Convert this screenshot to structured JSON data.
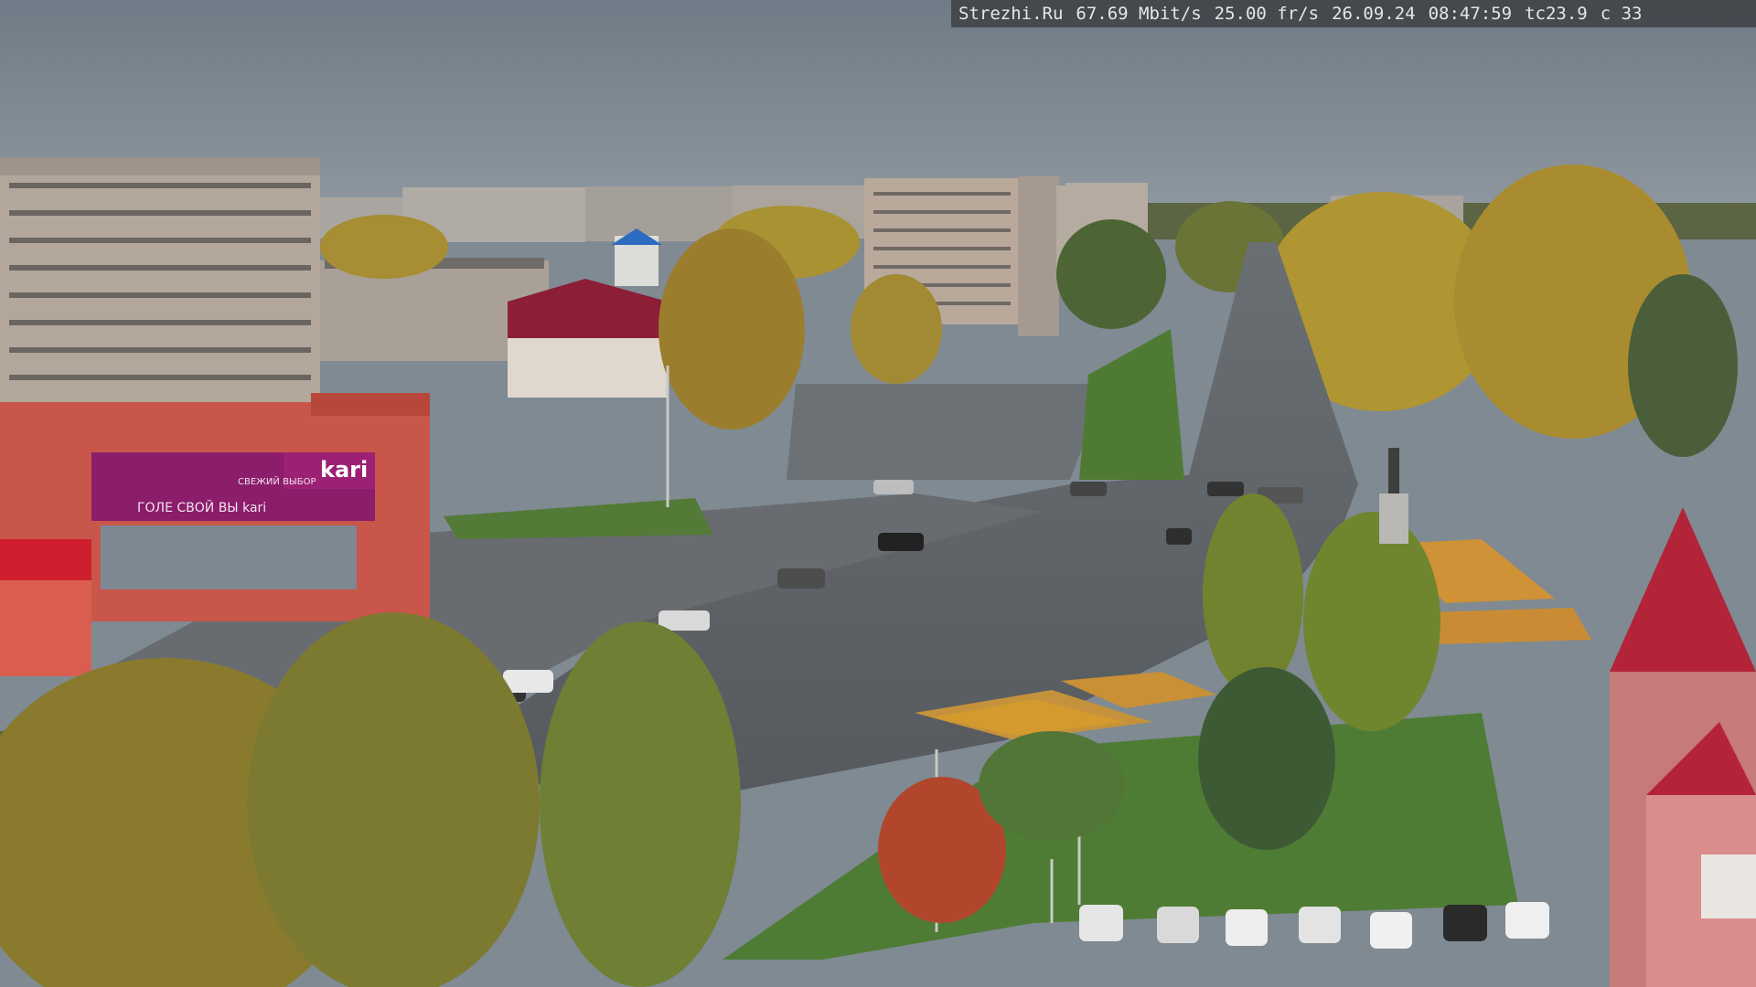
{
  "overlay": {
    "site": "Strezhi.Ru",
    "bitrate": "67.69 Mbit/s",
    "framerate": "25.00 fr/s",
    "date": "26.09.24",
    "time": "08:47:59",
    "temp": "tc23.9",
    "code": "c 33"
  },
  "signs": {
    "store_logo": "kari",
    "store_banner": "ГОЛЕ СВОЙ ВЫ kari",
    "store_banner_left": "СВЕЖИЙ ВЫБОР"
  },
  "colors": {
    "sky": "#7f8a94",
    "asphalt": "#5e6266",
    "grass": "#4f7a34",
    "foliage_gold": "#b89a3a",
    "store_red": "#c8493c",
    "magenta": "#8b1d6b",
    "roof_red": "#b3243a"
  }
}
